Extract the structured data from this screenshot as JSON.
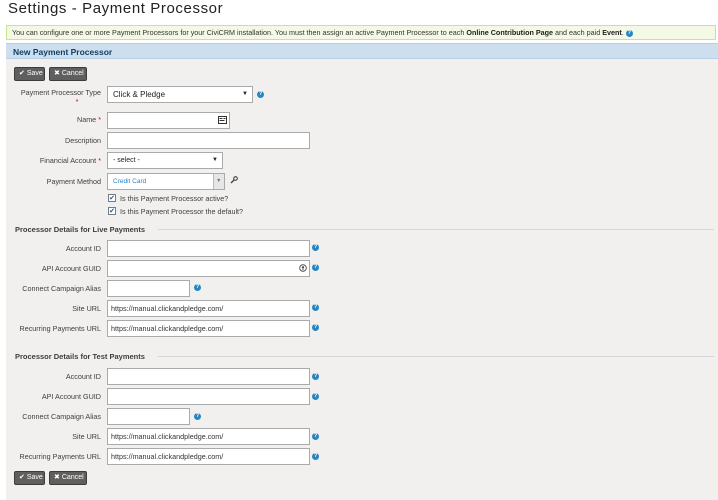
{
  "page": {
    "title": "Settings - Payment Processor"
  },
  "help": {
    "text_part1": "You can configure one or more Payment Processors for your CiviCRM installation. You must then assign an active Payment Processor to each ",
    "bold1": "Online Contribution Page",
    "text_part2": " and each paid ",
    "bold2": "Event",
    "text_part3": "."
  },
  "panel": {
    "title": "New Payment Processor"
  },
  "buttons": {
    "save": "Save",
    "cancel": "Cancel"
  },
  "form": {
    "processor_type": {
      "label": "Payment Processor Type",
      "required": "*",
      "value": "Click & Pledge"
    },
    "name": {
      "label": "Name",
      "required": "*",
      "value": ""
    },
    "description": {
      "label": "Description",
      "value": ""
    },
    "financial_account": {
      "label": "Financial Account",
      "required": "*",
      "value": "- select -"
    },
    "payment_method": {
      "label": "Payment Method",
      "value": "Credit Card"
    },
    "active_checkbox": {
      "label": "Is this Payment Processor active?",
      "checked": true
    },
    "default_checkbox": {
      "label": "Is this Payment Processor the default?",
      "checked": true
    }
  },
  "live": {
    "title": "Processor Details for Live Payments",
    "account_id": {
      "label": "Account ID",
      "value": ""
    },
    "api_guid": {
      "label": "API Account GUID",
      "value": ""
    },
    "campaign_alias": {
      "label": "Connect Campaign Alias",
      "value": ""
    },
    "site_url": {
      "label": "Site URL",
      "value": "https://manual.clickandpledge.com/"
    },
    "recurring_url": {
      "label": "Recurring Payments URL",
      "value": "https://manual.clickandpledge.com/"
    }
  },
  "test": {
    "title": "Processor Details for Test Payments",
    "account_id": {
      "label": "Account ID",
      "value": ""
    },
    "api_guid": {
      "label": "API Account GUID",
      "value": ""
    },
    "campaign_alias": {
      "label": "Connect Campaign Alias",
      "value": ""
    },
    "site_url": {
      "label": "Site URL",
      "value": "https://manual.clickandpledge.com/"
    },
    "recurring_url": {
      "label": "Recurring Payments URL",
      "value": "https://manual.clickandpledge.com/"
    }
  },
  "icons": {
    "help": "?",
    "check": "✔",
    "close": "✖",
    "arrow_down": "▼",
    "wrench": "wrench-icon",
    "card": "contact-card-icon",
    "key": "key-icon"
  },
  "colors": {
    "header_bg": "#cddfee",
    "help_bg": "#f3f9e5",
    "button_bg": "#5f5f5f",
    "link_blue": "#2786c2"
  }
}
